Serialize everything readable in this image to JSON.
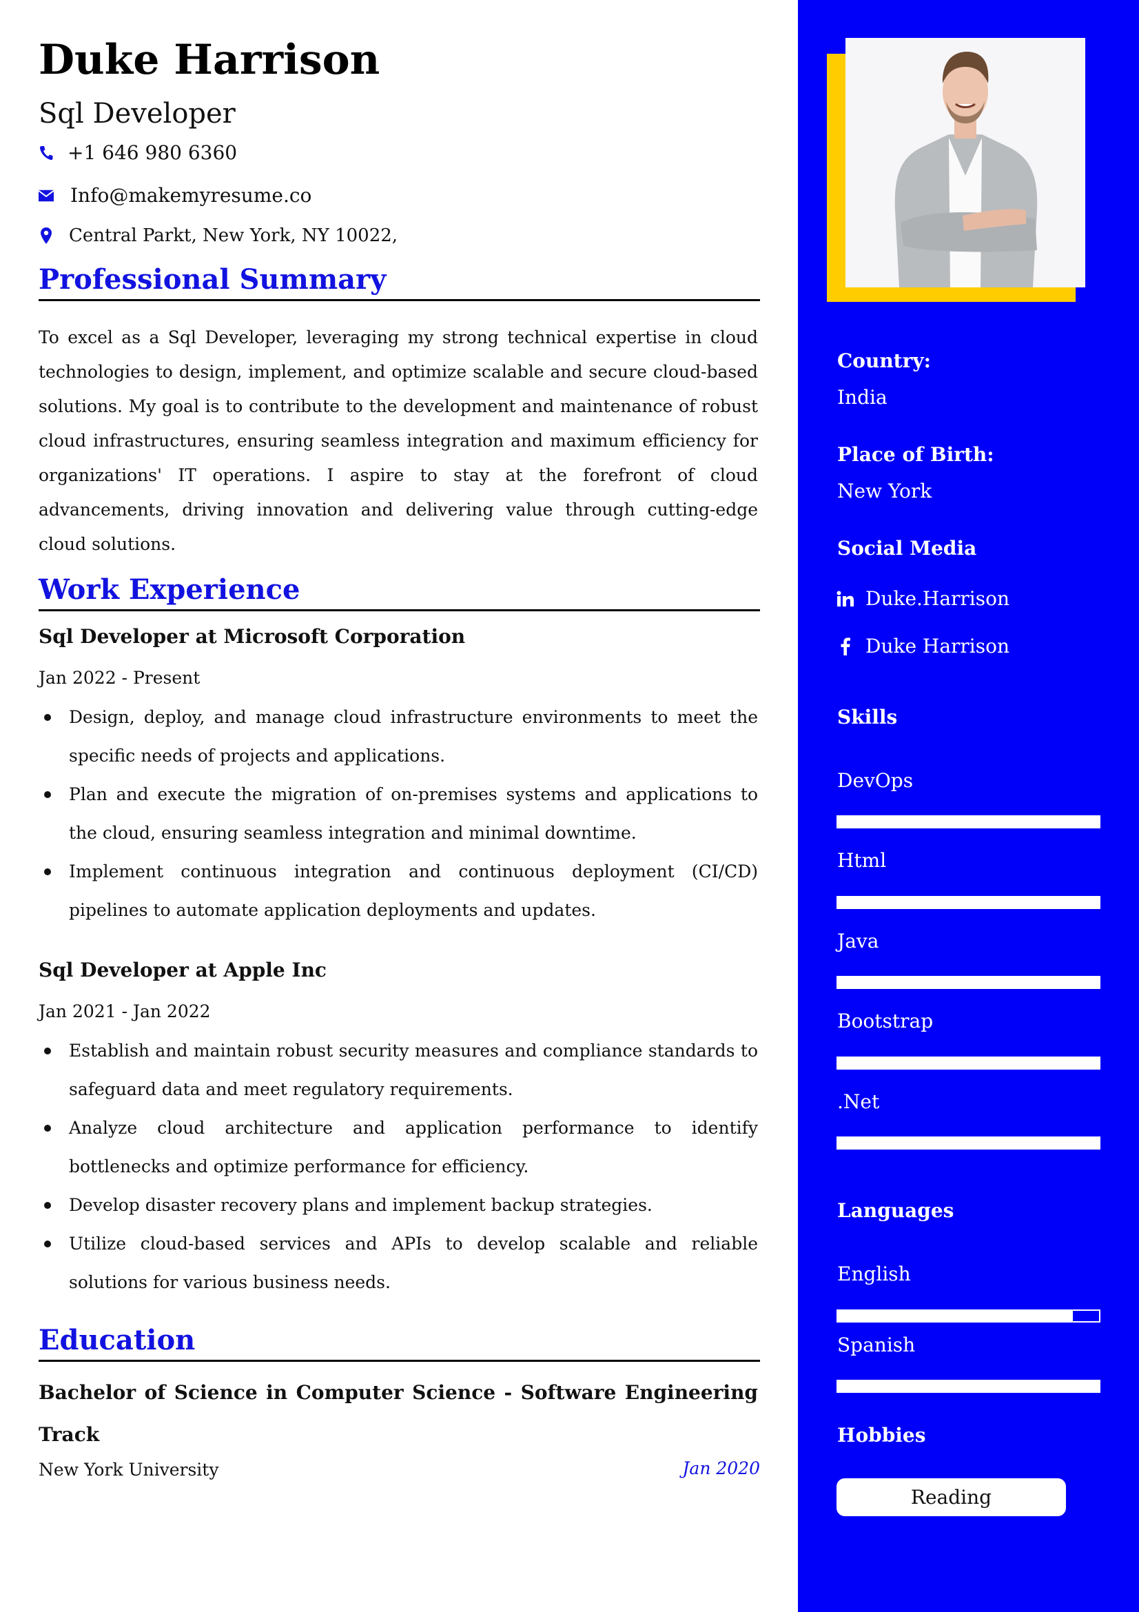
{
  "header": {
    "name": "Duke Harrison",
    "title": "Sql Developer",
    "phone": "+1 646 980 6360",
    "email": "Info@makemyresume.co",
    "address": "Central Parkt, New York, NY 10022,",
    "icons": {
      "phone": "phone-icon",
      "email": "envelope-icon",
      "address": "map-pin-icon"
    }
  },
  "summary": {
    "heading": "Professional Summary",
    "text": "To excel as a Sql Developer, leveraging my strong technical expertise in cloud technologies to design, implement, and optimize scalable and secure cloud-based solutions. My goal is to contribute to the development and maintenance of robust cloud infrastructures, ensuring seamless integration and maximum efficiency for organizations' IT operations. I aspire to stay at the forefront of cloud advancements, driving innovation and delivering value through cutting-edge cloud solutions."
  },
  "experience": {
    "heading": "Work Experience",
    "jobs": [
      {
        "title": "Sql Developer at Microsoft Corporation",
        "dates": "Jan 2022 - Present",
        "bullets": [
          "Design, deploy, and manage cloud infrastructure environments to meet the specific needs of projects and applications.",
          "Plan and execute the migration of on-premises systems and applications to the cloud, ensuring seamless integration and minimal downtime.",
          "Implement continuous integration and continuous deployment (CI/CD) pipelines to automate application deployments and updates."
        ]
      },
      {
        "title": "Sql Developer at Apple Inc",
        "dates": "Jan 2021 - Jan 2022",
        "bullets": [
          "Establish and maintain robust security measures and compliance standards to safeguard data and meet regulatory requirements.",
          "Analyze cloud architecture and application performance to identify bottlenecks and optimize performance for efficiency.",
          "Develop disaster recovery plans and implement backup strategies.",
          "Utilize cloud-based services and APIs to develop scalable and reliable solutions for various business needs."
        ]
      }
    ]
  },
  "education": {
    "heading": "Education",
    "degree": "Bachelor of Science in Computer Science - Software Engineering Track",
    "school": "New York University",
    "date": "Jan 2020"
  },
  "sidebar": {
    "country_label": "Country:",
    "country": "India",
    "birth_label": "Place of Birth:",
    "birth": "New York",
    "social_heading": "Social Media",
    "social": [
      {
        "icon": "linkedin-icon",
        "label": "Duke.Harrison"
      },
      {
        "icon": "facebook-icon",
        "label": "Duke Harrison"
      }
    ],
    "skills_heading": "Skills",
    "skills": [
      {
        "label": "DevOps",
        "level_percent": 100
      },
      {
        "label": "Html",
        "level_percent": 100
      },
      {
        "label": "Java",
        "level_percent": 100
      },
      {
        "label": "Bootstrap",
        "level_percent": 100
      },
      {
        "label": ".Net",
        "level_percent": 100
      }
    ],
    "languages_heading": "Languages",
    "languages": [
      {
        "label": "English",
        "level_percent": 90
      },
      {
        "label": "Spanish",
        "level_percent": 100
      }
    ],
    "hobbies_heading": "Hobbies",
    "hobbies": [
      "Reading"
    ]
  },
  "colors": {
    "sidebar": "#0000fa",
    "accent_heading": "#1212e0",
    "photo_frame": "#ffcc00"
  }
}
